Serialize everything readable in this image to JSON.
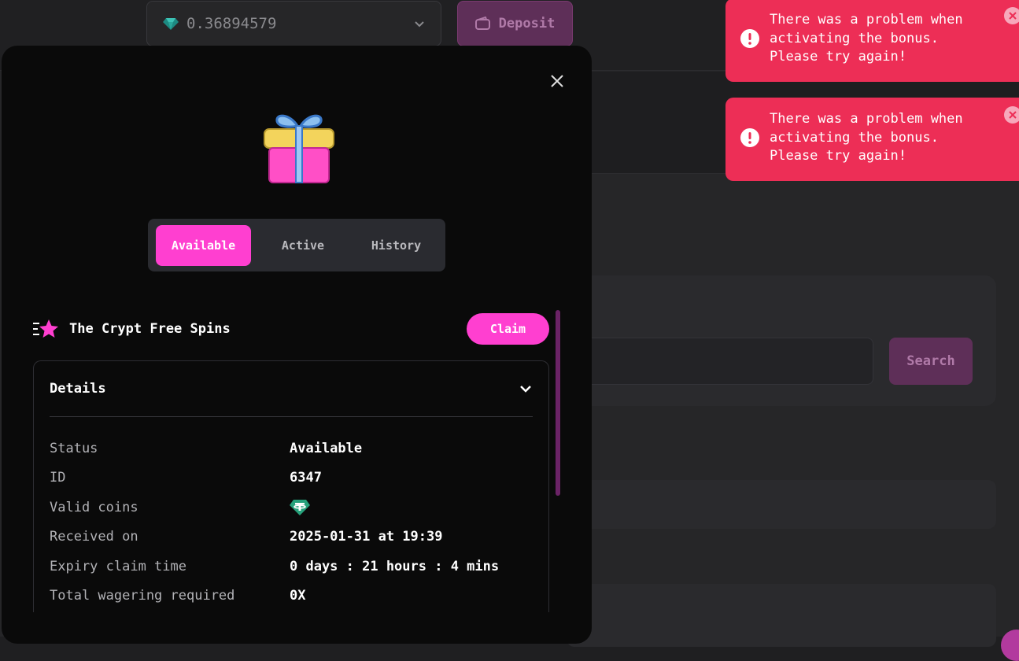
{
  "header": {
    "balance_value": "0.36894579",
    "deposit_label": "Deposit"
  },
  "background": {
    "search_label": "Search"
  },
  "modal": {
    "tabs": [
      {
        "label": "Available",
        "active": true
      },
      {
        "label": "Active",
        "active": false
      },
      {
        "label": "History",
        "active": false
      }
    ],
    "promo": {
      "title": "The Crypt Free Spins",
      "claim_label": "Claim"
    },
    "details": {
      "title": "Details",
      "rows": [
        {
          "key": "Status",
          "value": "Available"
        },
        {
          "key": "ID",
          "value": "6347"
        },
        {
          "key": "Valid coins",
          "value": "",
          "icon": "tether-icon"
        },
        {
          "key": "Received on",
          "value": "2025-01-31 at 19:39"
        },
        {
          "key": "Expiry claim time",
          "value": "0 days : 21 hours : 4 mins"
        },
        {
          "key": "Total wagering required",
          "value": "0X"
        }
      ]
    }
  },
  "toasts": [
    {
      "message": "There was a problem when activating the bonus. Please try again!"
    },
    {
      "message": "There was a problem when activating the bonus. Please try again!"
    }
  ],
  "colors": {
    "accent": "#ff3fd0",
    "toast": "#ed2e56",
    "modal_bg": "#0a0a0a",
    "tether": "#26a17b"
  }
}
